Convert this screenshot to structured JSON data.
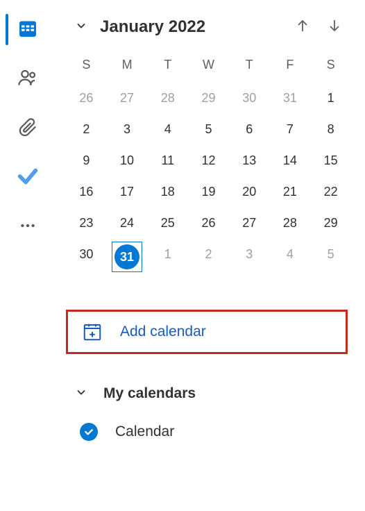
{
  "month_header": "January 2022",
  "day_headers": [
    "S",
    "M",
    "T",
    "W",
    "T",
    "F",
    "S"
  ],
  "weeks": [
    [
      {
        "d": "26",
        "other": true
      },
      {
        "d": "27",
        "other": true
      },
      {
        "d": "28",
        "other": true
      },
      {
        "d": "29",
        "other": true
      },
      {
        "d": "30",
        "other": true
      },
      {
        "d": "31",
        "other": true
      },
      {
        "d": "1"
      }
    ],
    [
      {
        "d": "2"
      },
      {
        "d": "3"
      },
      {
        "d": "4"
      },
      {
        "d": "5"
      },
      {
        "d": "6"
      },
      {
        "d": "7"
      },
      {
        "d": "8"
      }
    ],
    [
      {
        "d": "9"
      },
      {
        "d": "10"
      },
      {
        "d": "11"
      },
      {
        "d": "12"
      },
      {
        "d": "13"
      },
      {
        "d": "14"
      },
      {
        "d": "15"
      }
    ],
    [
      {
        "d": "16"
      },
      {
        "d": "17"
      },
      {
        "d": "18"
      },
      {
        "d": "19"
      },
      {
        "d": "20"
      },
      {
        "d": "21"
      },
      {
        "d": "22"
      }
    ],
    [
      {
        "d": "23"
      },
      {
        "d": "24"
      },
      {
        "d": "25"
      },
      {
        "d": "26"
      },
      {
        "d": "27"
      },
      {
        "d": "28"
      },
      {
        "d": "29"
      }
    ],
    [
      {
        "d": "30"
      },
      {
        "d": "31",
        "today": true
      },
      {
        "d": "1",
        "other": true
      },
      {
        "d": "2",
        "other": true
      },
      {
        "d": "3",
        "other": true
      },
      {
        "d": "4",
        "other": true
      },
      {
        "d": "5",
        "other": true
      }
    ]
  ],
  "add_calendar_label": "Add calendar",
  "my_calendars_label": "My calendars",
  "calendars": [
    {
      "name": "Calendar",
      "checked": true
    }
  ]
}
